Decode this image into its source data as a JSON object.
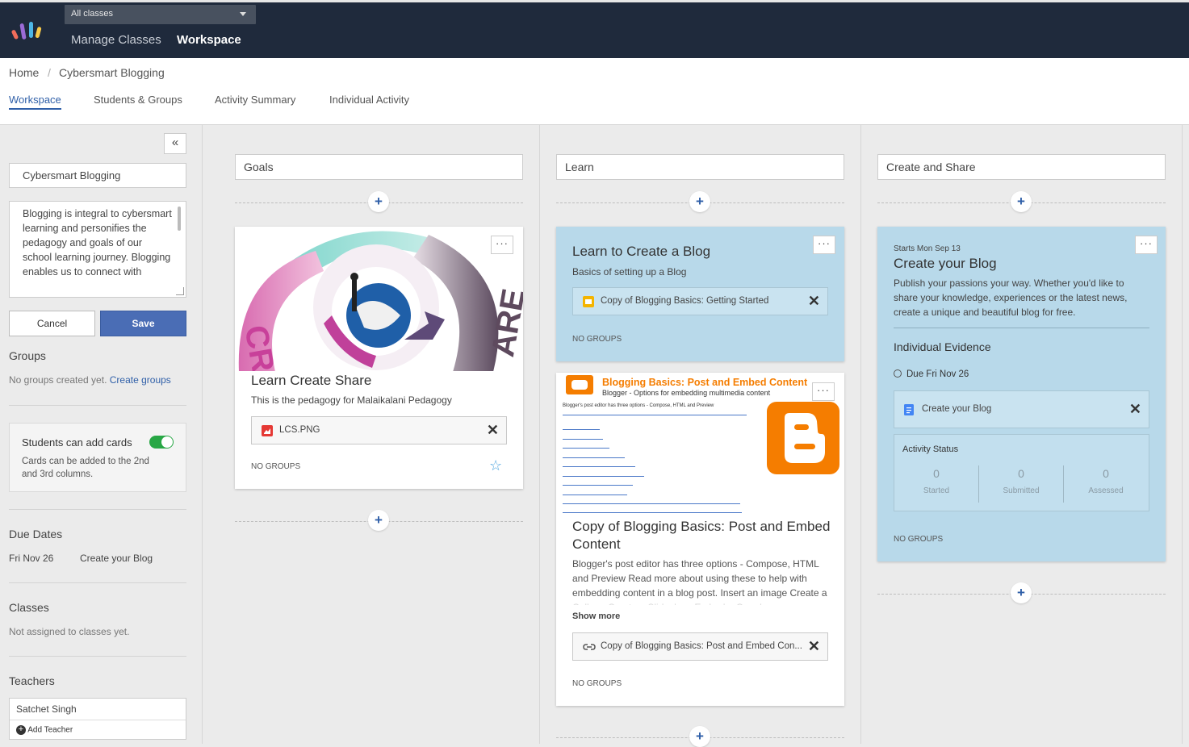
{
  "topbar": {
    "class_select": "All classes",
    "nav": [
      "Manage Classes",
      "Workspace"
    ]
  },
  "breadcrumb": {
    "home": "Home",
    "sep": "/",
    "current": "Cybersmart Blogging"
  },
  "tabs": [
    "Workspace",
    "Students & Groups",
    "Activity Summary",
    "Individual Activity"
  ],
  "sidebar": {
    "collapse_icon": "«",
    "name_value": "Cybersmart Blogging",
    "description": "Blogging is integral to cybersmart learning and personifies the pedagogy and goals of our school learning journey. Blogging enables us to connect with",
    "cancel_label": "Cancel",
    "save_label": "Save",
    "groups_title": "Groups",
    "groups_text": "No groups created yet.",
    "groups_link": "Create groups",
    "toggle_title": "Students can add cards",
    "toggle_text": "Cards can be added to the 2nd and 3rd columns.",
    "due_title": "Due Dates",
    "due_date": "Fri Nov 26",
    "due_item": "Create your Blog",
    "classes_title": "Classes",
    "classes_text": "Not assigned to classes yet.",
    "teachers_title": "Teachers",
    "teacher_name": "Satchet Singh",
    "add_teacher": "Add Teacher"
  },
  "columns": [
    {
      "title": "Goals"
    },
    {
      "title": "Learn"
    },
    {
      "title": "Create and Share"
    }
  ],
  "cards": {
    "lcs": {
      "more": "···",
      "title": "Learn Create Share",
      "subtitle": "This is the pedagogy for Malaikalani Pedagogy",
      "attachment": "LCS.PNG",
      "groups": "NO GROUPS",
      "image_text_left": "CRE",
      "image_text_right": "ARE"
    },
    "learn_blog": {
      "more": "···",
      "title": "Learn to Create a Blog",
      "subtitle": "Basics of setting up a Blog",
      "attachment": "Copy of Blogging Basics: Getting Started",
      "groups": "NO GROUPS"
    },
    "post_embed": {
      "more": "···",
      "image_title": "Blogging Basics: Post and Embed Content",
      "image_sub": "Blogger - Options for embedding multimedia content",
      "image_desc": "Blogger's post editor has three options - Compose, HTML and Preview",
      "title": "Copy of Blogging Basics: Post and Embed Content",
      "description": "Blogger's post editor has three options - Compose, HTML and Preview Read more about using these to help with embedding content in a blog post. Insert an image Create a Collage Create a Slideshow Embed a Google",
      "show_more": "Show more",
      "attachment": "Copy of Blogging Basics: Post and Embed Con...",
      "groups": "NO GROUPS"
    },
    "create_blog": {
      "more": "···",
      "starts": "Starts Mon Sep 13",
      "title": "Create your Blog",
      "description": "Publish your passions your way. Whether you'd like to share your knowledge, experiences or the latest news, create a unique and beautiful blog for free.",
      "evidence_title": "Individual Evidence",
      "due": "Due Fri Nov 26",
      "attachment": "Create your Blog",
      "status_title": "Activity Status",
      "stats": [
        {
          "value": "0",
          "label": "Started"
        },
        {
          "value": "0",
          "label": "Submitted"
        },
        {
          "value": "0",
          "label": "Assessed"
        }
      ],
      "groups": "NO GROUPS"
    }
  },
  "plus_label": "+",
  "colors": {
    "nav_bg": "#1f2a3c",
    "accent": "#2f5fa8",
    "card_blue": "#b8d9ea",
    "toggle_on": "#28a745"
  }
}
